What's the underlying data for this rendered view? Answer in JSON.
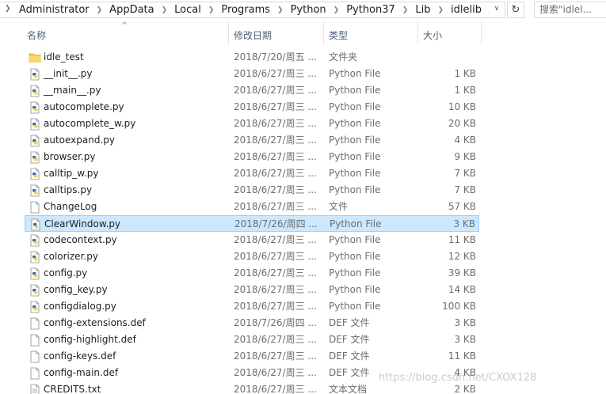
{
  "address": {
    "crumbs": [
      "Administrator",
      "AppData",
      "Local",
      "Programs",
      "Python",
      "Python37",
      "Lib",
      "idlelib"
    ],
    "lead_glyph": "❯",
    "separator": "❯",
    "dropdown_glyph": "∨",
    "refresh_glyph": "↻"
  },
  "search": {
    "placeholder": "搜索\"idlel..."
  },
  "columns": {
    "name": "名称",
    "date": "修改日期",
    "type": "类型",
    "size": "大小",
    "sort_glyph": "^"
  },
  "files": [
    {
      "name": "idle_test",
      "date": "2018/7/20/周五 ...",
      "type": "文件夹",
      "size": "",
      "icon": "folder-icon"
    },
    {
      "name": "__init__.py",
      "date": "2018/6/27/周三 ...",
      "type": "Python File",
      "size": "1 KB",
      "icon": "python-file-icon"
    },
    {
      "name": "__main__.py",
      "date": "2018/6/27/周三 ...",
      "type": "Python File",
      "size": "1 KB",
      "icon": "python-file-icon"
    },
    {
      "name": "autocomplete.py",
      "date": "2018/6/27/周三 ...",
      "type": "Python File",
      "size": "10 KB",
      "icon": "python-file-icon"
    },
    {
      "name": "autocomplete_w.py",
      "date": "2018/6/27/周三 ...",
      "type": "Python File",
      "size": "20 KB",
      "icon": "python-file-icon"
    },
    {
      "name": "autoexpand.py",
      "date": "2018/6/27/周三 ...",
      "type": "Python File",
      "size": "4 KB",
      "icon": "python-file-icon"
    },
    {
      "name": "browser.py",
      "date": "2018/6/27/周三 ...",
      "type": "Python File",
      "size": "9 KB",
      "icon": "python-file-icon"
    },
    {
      "name": "calltip_w.py",
      "date": "2018/6/27/周三 ...",
      "type": "Python File",
      "size": "7 KB",
      "icon": "python-file-icon"
    },
    {
      "name": "calltips.py",
      "date": "2018/6/27/周三 ...",
      "type": "Python File",
      "size": "7 KB",
      "icon": "python-file-icon"
    },
    {
      "name": "ChangeLog",
      "date": "2018/6/27/周三 ...",
      "type": "文件",
      "size": "57 KB",
      "icon": "blank-file-icon"
    },
    {
      "name": "ClearWindow.py",
      "date": "2018/7/26/周四 ...",
      "type": "Python File",
      "size": "3 KB",
      "icon": "python-file-icon",
      "selected": true
    },
    {
      "name": "codecontext.py",
      "date": "2018/6/27/周三 ...",
      "type": "Python File",
      "size": "11 KB",
      "icon": "python-file-icon"
    },
    {
      "name": "colorizer.py",
      "date": "2018/6/27/周三 ...",
      "type": "Python File",
      "size": "12 KB",
      "icon": "python-file-icon"
    },
    {
      "name": "config.py",
      "date": "2018/6/27/周三 ...",
      "type": "Python File",
      "size": "39 KB",
      "icon": "python-file-icon"
    },
    {
      "name": "config_key.py",
      "date": "2018/6/27/周三 ...",
      "type": "Python File",
      "size": "14 KB",
      "icon": "python-file-icon"
    },
    {
      "name": "configdialog.py",
      "date": "2018/6/27/周三 ...",
      "type": "Python File",
      "size": "100 KB",
      "icon": "python-file-icon"
    },
    {
      "name": "config-extensions.def",
      "date": "2018/7/26/周四 ...",
      "type": "DEF 文件",
      "size": "3 KB",
      "icon": "blank-file-icon"
    },
    {
      "name": "config-highlight.def",
      "date": "2018/6/27/周三 ...",
      "type": "DEF 文件",
      "size": "3 KB",
      "icon": "blank-file-icon"
    },
    {
      "name": "config-keys.def",
      "date": "2018/6/27/周三 ...",
      "type": "DEF 文件",
      "size": "11 KB",
      "icon": "blank-file-icon"
    },
    {
      "name": "config-main.def",
      "date": "2018/6/27/周三 ...",
      "type": "DEF 文件",
      "size": "4 KB",
      "icon": "blank-file-icon"
    },
    {
      "name": "CREDITS.txt",
      "date": "2018/6/27/周三 ...",
      "type": "文本文档",
      "size": "2 KB",
      "icon": "text-file-icon"
    }
  ],
  "watermark": "https://blog.csdn.net/CXOX128",
  "colors": {
    "selected_bg": "#cce8ff",
    "selected_border": "#99d1ff",
    "header_text": "#4c607a",
    "secondary_text": "#6d6d6d",
    "folder": "#f5c94c",
    "python_blue": "#3a76b0",
    "python_yellow": "#f7d047"
  }
}
